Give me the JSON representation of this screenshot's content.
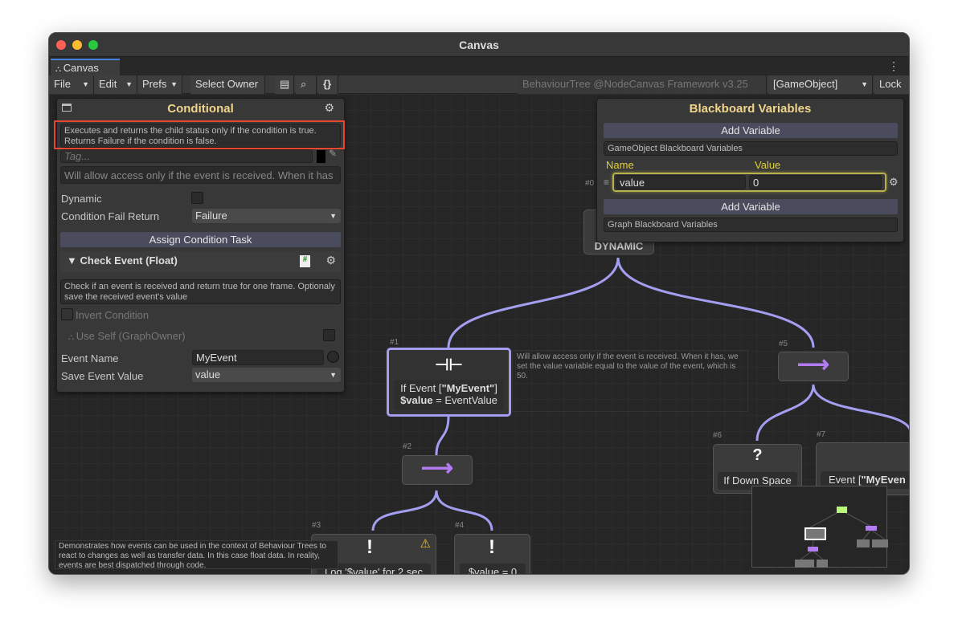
{
  "window": {
    "title": "Canvas",
    "tab": "Canvas"
  },
  "toolbar": {
    "file": "File",
    "edit": "Edit",
    "prefs": "Prefs",
    "select_owner": "Select Owner",
    "graph_info": "BehaviourTree @NodeCanvas Framework v3.25",
    "owner_select": "[GameObject]",
    "lock": "Lock"
  },
  "inspector": {
    "title": "Conditional",
    "description": "Executes and returns the child status only if the condition is true. Returns Failure if the condition is false.",
    "tag_placeholder": "Tag...",
    "comment": "Will allow access only if the event is received. When it has",
    "dynamic_label": "Dynamic",
    "fail_return_label": "Condition Fail Return",
    "fail_return_value": "Failure",
    "assign_task": "Assign Condition Task",
    "task_title": "Check Event (Float)",
    "task_description": "Check if an event is received and return true for one frame. Optionaly save the received event's value",
    "invert_label": "Invert Condition",
    "use_self_label": "Use Self (GraphOwner)",
    "event_name_label": "Event Name",
    "event_name_value": "MyEvent",
    "save_value_label": "Save Event Value",
    "save_value_value": "value"
  },
  "blackboard": {
    "title": "Blackboard Variables",
    "add_variable": "Add Variable",
    "gameobject_section": "GameObject Blackboard Variables",
    "name_header": "Name",
    "value_header": "Value",
    "variables": [
      {
        "name": "value",
        "value": "0"
      }
    ],
    "add_variable_2": "Add Variable",
    "graph_section": "Graph Blackboard Variables"
  },
  "nodes": {
    "n0": {
      "id": "#0",
      "text": "DYNAMIC"
    },
    "n1": {
      "id": "#1",
      "line1_pre": "If Event [",
      "line1_bold": "\"MyEvent\"",
      "line1_post": "]",
      "line2_bold": "$value",
      "line2_post": " = EventValue"
    },
    "n1_comment": "Will allow access only if the event is received. When it has, we set the value variable equal to the value of the event, which is 50.",
    "n2": {
      "id": "#2"
    },
    "n3": {
      "id": "#3",
      "text": "Log '$value' for 2 sec"
    },
    "n4": {
      "id": "#4",
      "text": "$value = 0"
    },
    "n5": {
      "id": "#5"
    },
    "n6": {
      "id": "#6",
      "text": "If Down Space"
    },
    "n7": {
      "id": "#7",
      "text_pre": "Event [",
      "text_bold": "\"MyEven"
    }
  },
  "graph_comment": "Demonstrates how events can be used in the context of Behaviour Trees to react to changes as well as transfer data. In this case float data. In reality, events are best dispatched through code.",
  "colors": {
    "accent": "#a49ef0",
    "title": "#f1d58a",
    "highlight": "#e8472f",
    "sequencer": "#b37cf3"
  }
}
